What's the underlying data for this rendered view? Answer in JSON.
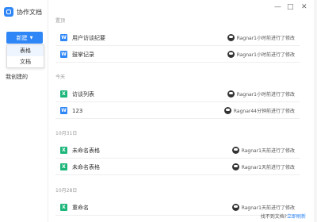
{
  "app": {
    "title": "协作文档"
  },
  "window_controls": {
    "min": "—",
    "max": "□",
    "close": "✕"
  },
  "sidebar": {
    "new_button": "新建",
    "dropdown_options": [
      "表格",
      "文档"
    ],
    "my_created": "我创建的"
  },
  "sections": [
    {
      "label": "置顶",
      "rows": [
        {
          "type": "doc",
          "title": "用户访谈纪要",
          "meta": "Ragnar1小时前进行了修改"
        },
        {
          "type": "doc",
          "title": "鼓掌记录",
          "meta": "Ragnar1小时前进行了修改"
        }
      ]
    },
    {
      "label": "今天",
      "rows": [
        {
          "type": "sheet",
          "title": "访谈列表",
          "meta": "Ragnar1小时前进行了修改"
        },
        {
          "type": "doc",
          "title": "123",
          "meta": "Ragnar44分钟前进行了修改"
        }
      ]
    },
    {
      "label": "10月31日",
      "rows": [
        {
          "type": "sheet",
          "title": "未命名表格",
          "meta": "Ragnar1天前进行了修改"
        },
        {
          "type": "sheet",
          "title": "未命名表格",
          "meta": "Ragnar1天前进行了修改"
        }
      ]
    },
    {
      "label": "10月28日",
      "rows": [
        {
          "type": "sheet",
          "title": "重命名",
          "meta": "Ragnar1天前进行了修改"
        }
      ]
    }
  ],
  "footer": {
    "hint": "找不到文档?",
    "link": "立即刷新"
  },
  "colors": {
    "accent": "#2f86f6",
    "sheet": "#1db67a"
  }
}
